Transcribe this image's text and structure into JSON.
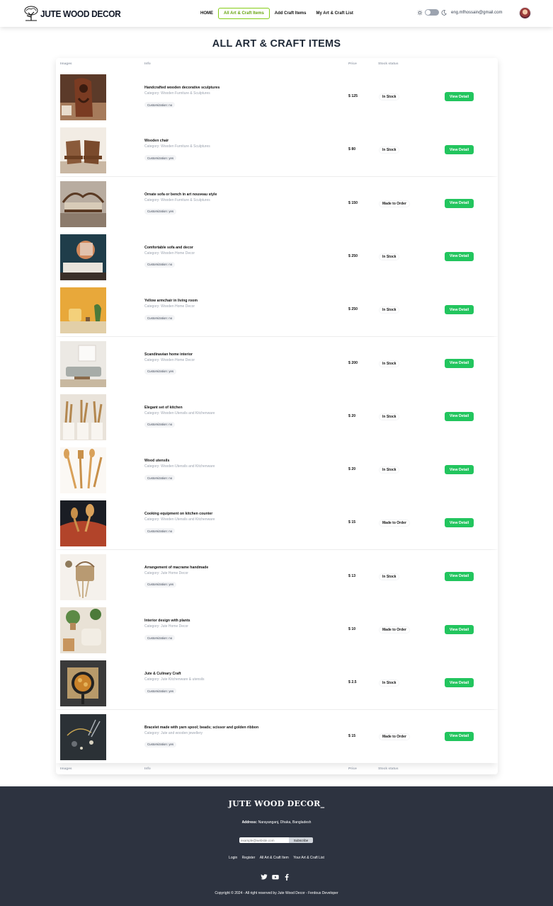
{
  "navbar": {
    "logo_text": "JUTE WOOD DECOR",
    "links": [
      "HOME",
      "All Art & Craft Items",
      "Add Craft Items",
      "My Art & Craft List"
    ],
    "user_email": "eng.mfhossain@gmail.com"
  },
  "page": {
    "title": "ALL ART & CRAFT ITEMS"
  },
  "table": {
    "headers": [
      "Images",
      "Info",
      "Price",
      "Stock status"
    ],
    "button_label": "View Detail",
    "rows": [
      {
        "name": "Handcrafted wooden decorative sculptures",
        "category": "Category: Wooden Furniture & Sculptures",
        "custom": "Customization: no",
        "price": "$ 125",
        "stock": "In Stock"
      },
      {
        "name": "Wooden chair",
        "category": "Category: Wooden Furniture & Sculptures",
        "custom": "Customization: yes",
        "price": "$ 80",
        "stock": "In Stock"
      },
      {
        "name": "Ornate sofa or bench in art nouveau style",
        "category": "Category: Wooden Furniture & Sculptures",
        "custom": "Customization: yes",
        "price": "$ 150",
        "stock": "Made to Order"
      },
      {
        "name": "Comfortable sofa and decor",
        "category": "Category: Wooden Home Decor",
        "custom": "Customization: no",
        "price": "$ 250",
        "stock": "In Stock"
      },
      {
        "name": "Yellow armchair in living room",
        "category": "Category: Wooden Home Decor",
        "custom": "Customization: no",
        "price": "$ 250",
        "stock": "In Stock"
      },
      {
        "name": "Scandinavian home interior",
        "category": "Category: Wooden Home Decor",
        "custom": "Customization: yes",
        "price": "$ 200",
        "stock": "In Stock"
      },
      {
        "name": "Elegant set of kitchen",
        "category": "Category: Wooden Utensils and Kitchenware",
        "custom": "Customization: no",
        "price": "$ 20",
        "stock": "In Stock"
      },
      {
        "name": "Wood utensils",
        "category": "Category: Wooden Utensils and Kitchenware",
        "custom": "Customization: no",
        "price": "$ 20",
        "stock": "In Stock"
      },
      {
        "name": "Cooking equipment on kitchen counter",
        "category": "Category: Wooden Utensils and Kitchenware",
        "custom": "Customization: no",
        "price": "$ 15",
        "stock": "Made to Order"
      },
      {
        "name": "Arrangement of macrame handmade",
        "category": "Category: Jute Home Decor",
        "custom": "Customization: yes",
        "price": "$ 13",
        "stock": "In Stock"
      },
      {
        "name": "Interior design with plants",
        "category": "Category: Jute Home Decor",
        "custom": "Customization: no",
        "price": "$ 10",
        "stock": "Made to Order"
      },
      {
        "name": "Jute & Culinary Craft",
        "category": "Category: Jute Kitchenware & utensils",
        "custom": "Customization: yes",
        "price": "$ 2.5",
        "stock": "In Stock"
      },
      {
        "name": "Bracelet made with yarn spool; beads; scissor and golden ribbon",
        "category": "Category: Jute and wooden jewellery",
        "custom": "Customization: yes",
        "price": "$ 15",
        "stock": "Made to Order"
      }
    ]
  },
  "footer": {
    "logo": "JUTE WOOD DECOR_",
    "address_label": "Address:",
    "address": "Narayanganj, Dhaka, Bangladesh",
    "subscribe_placeholder": "example@website.com",
    "subscribe_button": "Subscribe",
    "links": [
      "Login",
      "Register",
      "All Art & Craft Item",
      "Your Art & Craft List"
    ],
    "copyright": "Copyright © 2024 - All right reserved by Jute Wood Decor - Ferdous Developer"
  }
}
